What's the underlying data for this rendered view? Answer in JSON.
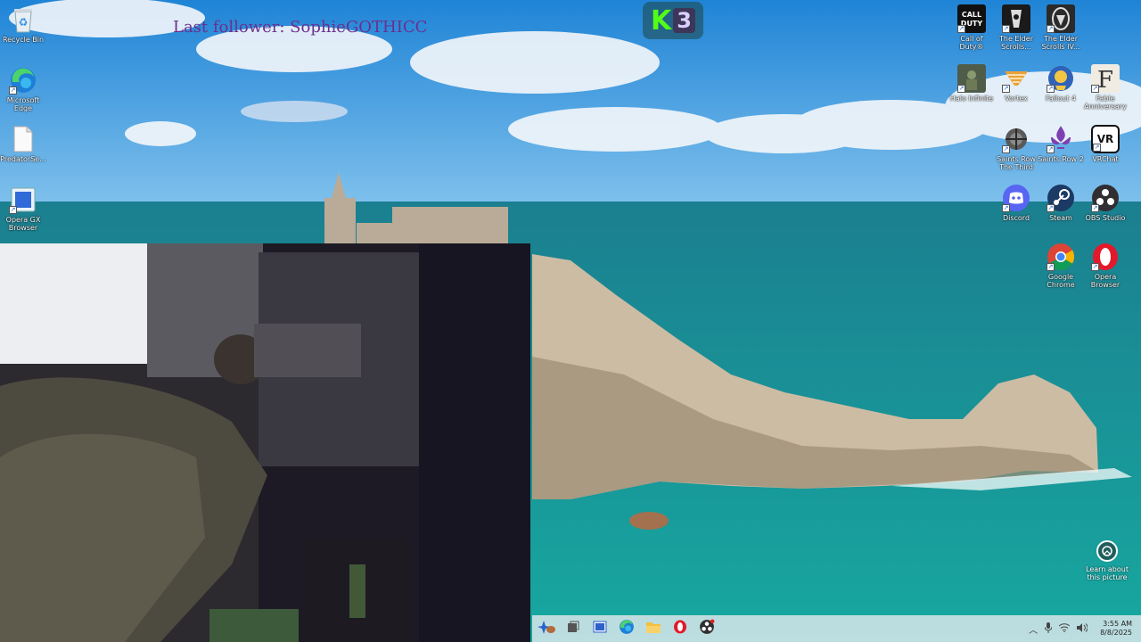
{
  "overlay": {
    "last_follower": "Last follower: SophieGOTHICC"
  },
  "kick_badge": {
    "letter": "K",
    "number": "3"
  },
  "desktop_left": [
    {
      "label": "Recycle Bin",
      "icon": "recycle-bin-icon"
    },
    {
      "label": "Microsoft Edge",
      "icon": "edge-icon"
    },
    {
      "label": "PredatorSe...",
      "icon": "file-icon"
    },
    {
      "label": "Opera GX Browser",
      "icon": "opera-gx-icon"
    }
  ],
  "desktop_right": [
    {
      "label": "Call of Duty®",
      "icon": "call-of-duty-icon"
    },
    {
      "label": "The Elder Scrolls...",
      "icon": "elder-scrolls-icon"
    },
    {
      "label": "The Elder Scrolls IV...",
      "icon": "elder-scrolls-iv-icon"
    },
    {
      "label": "Halo Infinite",
      "icon": "halo-icon"
    },
    {
      "label": "Vortex",
      "icon": "vortex-icon"
    },
    {
      "label": "Fallout 4",
      "icon": "fallout-icon"
    },
    {
      "label": "Fable Anniversary",
      "icon": "fable-icon"
    },
    {
      "label": "Saints Row The Third",
      "icon": "saints-row-third-icon"
    },
    {
      "label": "Saints Row 2",
      "icon": "saints-row-2-icon"
    },
    {
      "label": "VRChat",
      "icon": "vrchat-icon"
    },
    {
      "label": "Discord",
      "icon": "discord-icon"
    },
    {
      "label": "Steam",
      "icon": "steam-icon"
    },
    {
      "label": "OBS Studio",
      "icon": "obs-icon"
    },
    {
      "label": "Google Chrome",
      "icon": "chrome-icon"
    },
    {
      "label": "Opera Browser",
      "icon": "opera-icon"
    }
  ],
  "learn_picture": {
    "label": "Learn about this picture"
  },
  "taskbar": {
    "apps": [
      "copilot-icon",
      "task-view-icon",
      "widgets-icon",
      "edge-icon",
      "file-explorer-icon",
      "opera-icon",
      "obs-icon"
    ]
  },
  "clock": {
    "time": "3:55 AM",
    "date": "8/8/2025"
  }
}
